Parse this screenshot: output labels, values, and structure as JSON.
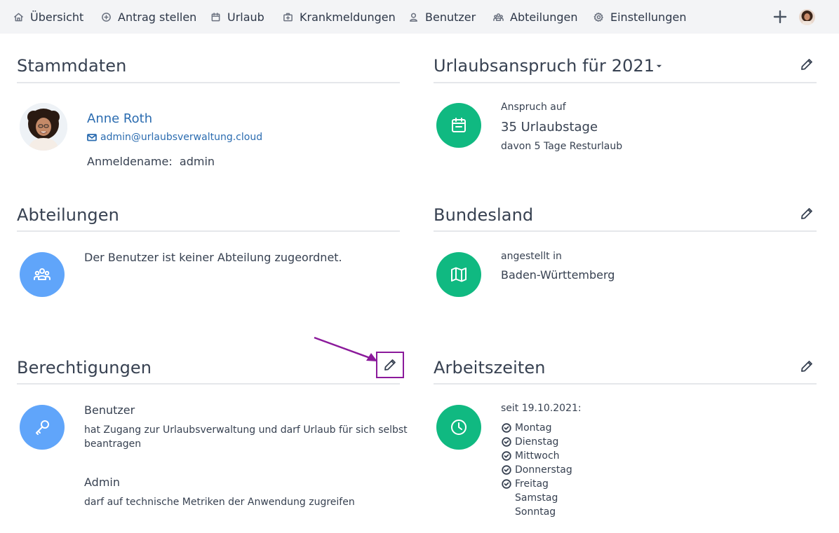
{
  "nav": {
    "items": [
      {
        "label": "Übersicht",
        "icon": "home-icon"
      },
      {
        "label": "Antrag stellen",
        "icon": "plus-circle-icon"
      },
      {
        "label": "Urlaub",
        "icon": "calendar-icon"
      },
      {
        "label": "Krankmeldungen",
        "icon": "medkit-icon"
      },
      {
        "label": "Benutzer",
        "icon": "user-icon"
      },
      {
        "label": "Abteilungen",
        "icon": "group-icon"
      },
      {
        "label": "Einstellungen",
        "icon": "gear-icon"
      }
    ]
  },
  "stammdaten": {
    "title": "Stammdaten",
    "name": "Anne Roth",
    "email": "admin@urlaubsverwaltung.cloud",
    "login_label": "Anmeldename:",
    "login_value": "admin"
  },
  "urlaubsanspruch": {
    "title": "Urlaubsanspruch für",
    "year": "2021",
    "label": "Anspruch auf",
    "value": "35 Urlaubstage",
    "remaining": "davon 5 Tage Resturlaub"
  },
  "abteilungen": {
    "title": "Abteilungen",
    "text": "Der Benutzer ist keiner Abteilung zugeordnet."
  },
  "bundesland": {
    "title": "Bundesland",
    "label": "angestellt in",
    "value": "Baden-Württemberg"
  },
  "berechtigungen": {
    "title": "Berechtigungen",
    "roles": [
      {
        "name": "Benutzer",
        "desc_line1": "hat Zugang zur Urlaubsverwaltung und darf Urlaub für sich selbst",
        "desc_line2": "beantragen"
      },
      {
        "name": "Admin",
        "desc_line1": "darf auf technische Metriken der Anwendung zugreifen",
        "desc_line2": ""
      }
    ]
  },
  "arbeitszeiten": {
    "title": "Arbeitszeiten",
    "since": "seit 19.10.2021:",
    "days": [
      {
        "label": "Montag",
        "working": true
      },
      {
        "label": "Dienstag",
        "working": true
      },
      {
        "label": "Mittwoch",
        "working": true
      },
      {
        "label": "Donnerstag",
        "working": true
      },
      {
        "label": "Freitag",
        "working": true
      },
      {
        "label": "Samstag",
        "working": false
      },
      {
        "label": "Sonntag",
        "working": false
      }
    ]
  },
  "colors": {
    "green": "#10b981",
    "blue": "#60a5fa",
    "link": "#2b6cb0",
    "highlight": "#8b1a9b"
  }
}
